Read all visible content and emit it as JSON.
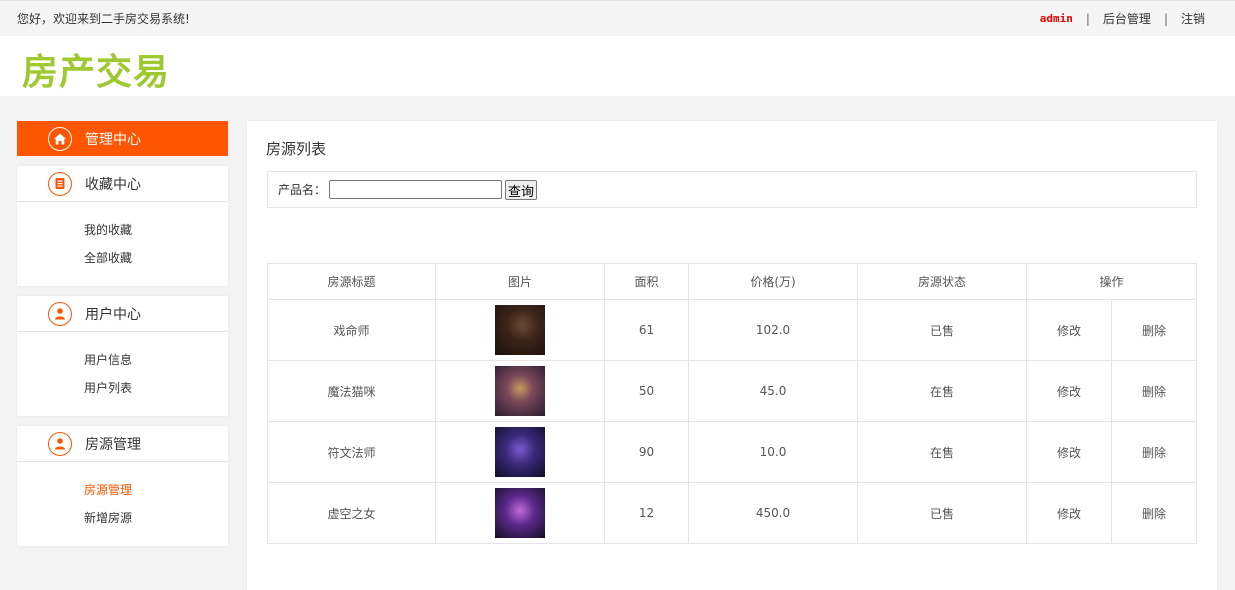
{
  "topbar": {
    "welcome": "您好，欢迎来到二手房交易系统!",
    "username": "admin",
    "separator": "|",
    "admin_link": "后台管理",
    "logout_link": "注销"
  },
  "header": {
    "logo": "房产交易"
  },
  "sidebar": {
    "active": {
      "label": "管理中心",
      "icon": "home-icon"
    },
    "sections": [
      {
        "title": "收藏中心",
        "icon": "document-icon",
        "links": [
          "我的收藏",
          "全部收藏"
        ]
      },
      {
        "title": "用户中心",
        "icon": "user-icon",
        "links": [
          "用户信息",
          "用户列表"
        ]
      },
      {
        "title": "房源管理",
        "icon": "user-icon",
        "links": [
          "房源管理",
          "新增房源"
        ]
      }
    ]
  },
  "colors": {
    "accent": "#fe5500",
    "logo": "#9ec930",
    "username": "#e60000"
  },
  "main": {
    "title": "房源列表",
    "search": {
      "label": "产品名：",
      "value": "",
      "button": "查询"
    },
    "table": {
      "headers": [
        "房源标题",
        "图片",
        "面积",
        "价格(万)",
        "房源状态",
        "操作"
      ],
      "rows": [
        {
          "title": "戏命师",
          "area": "61",
          "price": "102.0",
          "status": "已售",
          "edit": "修改",
          "delete": "删除"
        },
        {
          "title": "魔法猫咪",
          "area": "50",
          "price": "45.0",
          "status": "在售",
          "edit": "修改",
          "delete": "删除"
        },
        {
          "title": "符文法师",
          "area": "90",
          "price": "10.0",
          "status": "在售",
          "edit": "修改",
          "delete": "删除"
        },
        {
          "title": "虚空之女",
          "area": "12",
          "price": "450.0",
          "status": "已售",
          "edit": "修改",
          "delete": "删除"
        }
      ]
    }
  }
}
